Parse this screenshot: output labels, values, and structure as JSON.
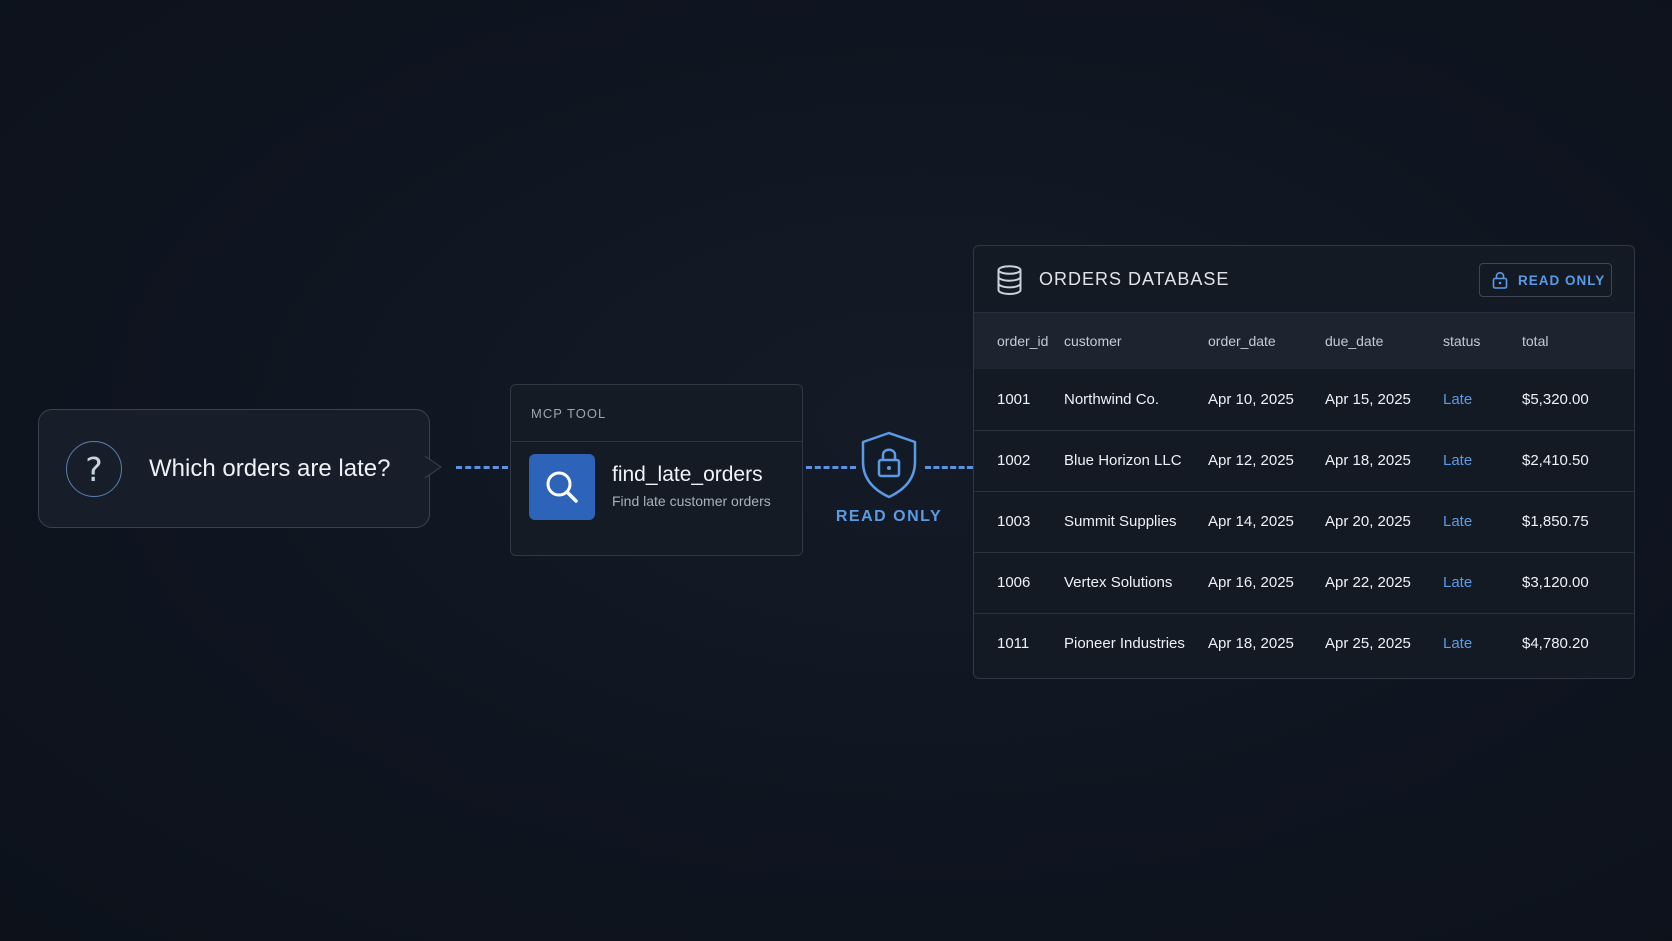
{
  "question": {
    "icon": "question-mark-icon",
    "text": "Which orders are late?"
  },
  "tool": {
    "header": "MCP TOOL",
    "icon": "search-icon",
    "name": "find_late_orders",
    "description": "Find late customer orders"
  },
  "guard": {
    "icon": "shield-lock-icon",
    "label": "READ ONLY"
  },
  "database": {
    "icon": "database-icon",
    "title": "ORDERS DATABASE",
    "badge_icon": "lock-icon",
    "badge": "READ ONLY",
    "columns": [
      "order_id",
      "customer",
      "order_date",
      "due_date",
      "status",
      "total"
    ],
    "rows": [
      [
        "1001",
        "Northwind Co.",
        "Apr 10, 2025",
        "Apr 15, 2025",
        "Late",
        "$5,320.00"
      ],
      [
        "1002",
        "Blue Horizon LLC",
        "Apr 12, 2025",
        "Apr 18, 2025",
        "Late",
        "$2,410.50"
      ],
      [
        "1003",
        "Summit Supplies",
        "Apr 14, 2025",
        "Apr 20, 2025",
        "Late",
        "$1,850.75"
      ],
      [
        "1006",
        "Vertex Solutions",
        "Apr 16, 2025",
        "Apr 22, 2025",
        "Late",
        "$3,120.00"
      ],
      [
        "1011",
        "Pioneer Industries",
        "Apr 18, 2025",
        "Apr 25, 2025",
        "Late",
        "$4,780.20"
      ]
    ]
  },
  "colors": {
    "accent": "#5b9be6",
    "tool_icon_bg": "#2d63b8",
    "background": "#0f1520"
  }
}
